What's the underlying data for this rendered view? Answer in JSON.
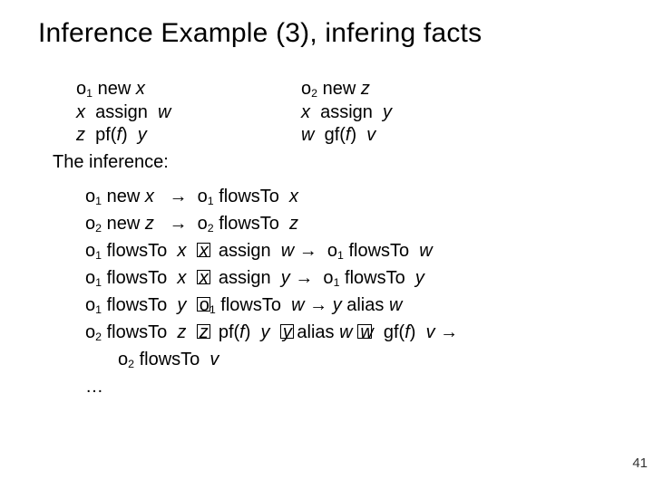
{
  "title": "Inference Example (3), infering facts",
  "facts": {
    "left": [
      "o1 new x",
      "x  assign  w",
      "z  pf(f)  y"
    ],
    "right": [
      "o2 new z",
      "x  assign  y",
      "w  gf(f)  v"
    ]
  },
  "subhead": "The inference:",
  "inference_lines": [
    "o1 new x   →  o1 flowsTo  x",
    "o2 new z   →  o2 flowsTo  z",
    "o1 flowsTo  x  □x  assign  w →  o1 flowsTo  w",
    "o1 flowsTo  x  □x  assign  y →  o1 flowsTo  y",
    "o1 flowsTo  y  □o1 flowsTo  w → y alias w",
    "o2 flowsTo  z  □z  pf(f)  y  □y alias w □w  gf(f)  v →",
    "o2 flowsTo  v",
    "…"
  ],
  "pagenum": "41"
}
